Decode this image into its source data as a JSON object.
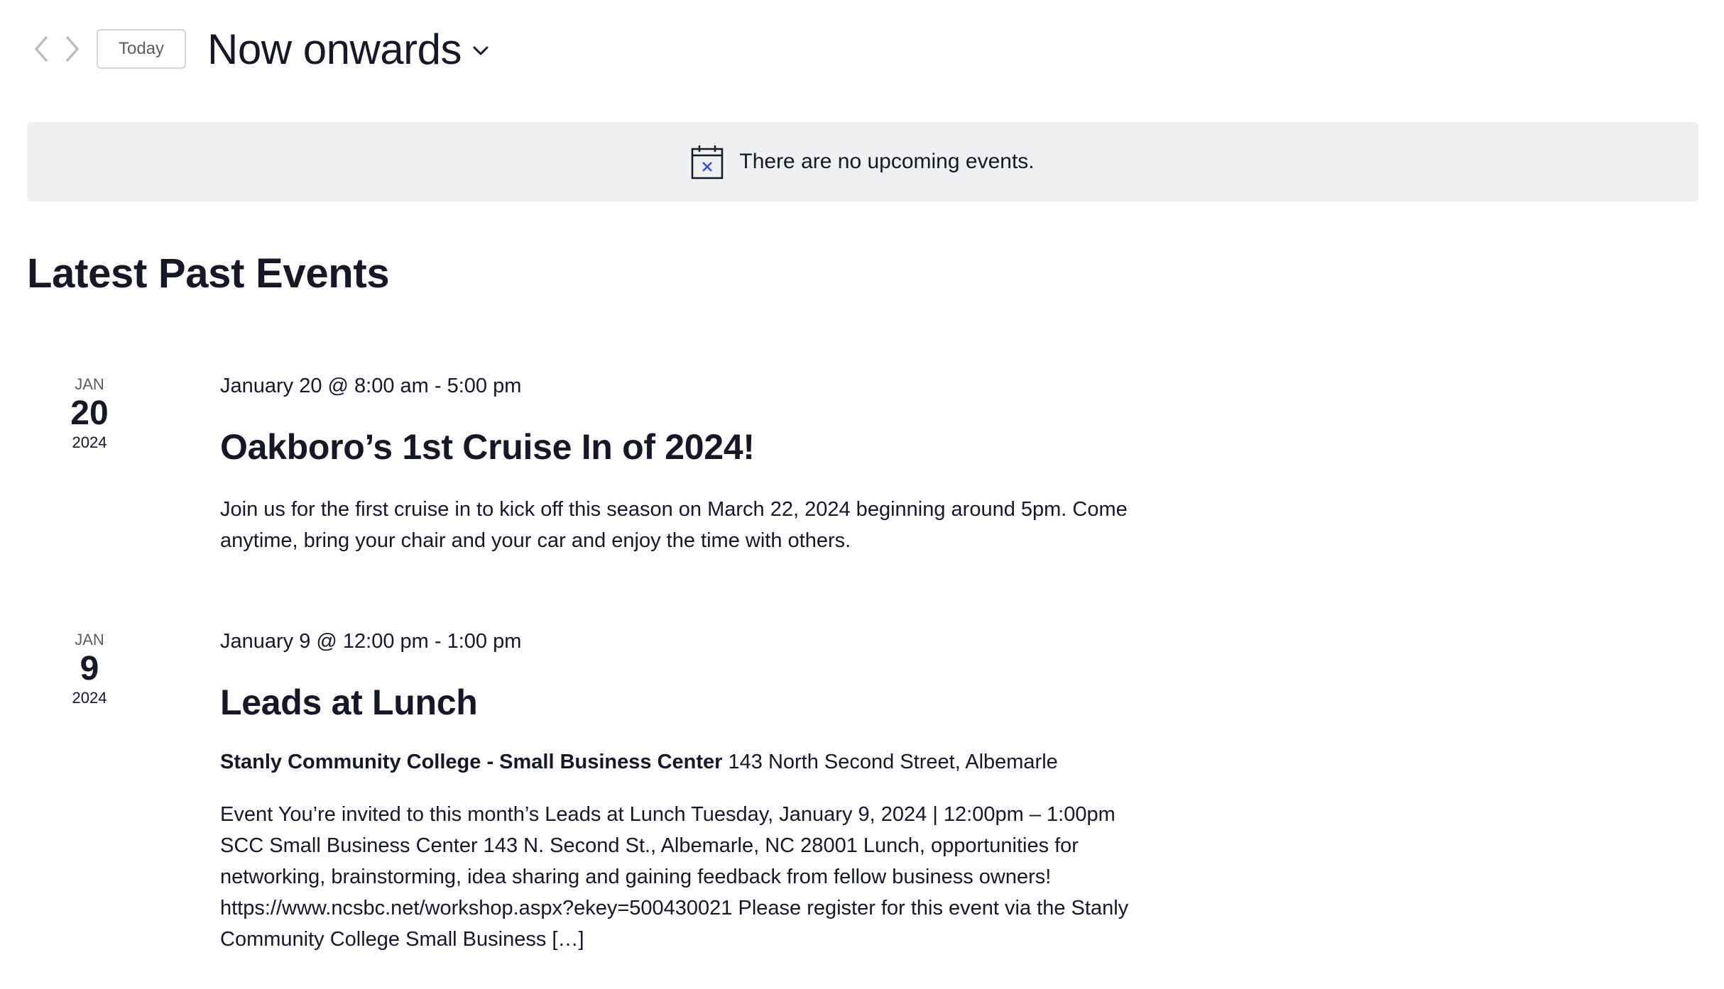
{
  "nav": {
    "prev_icon": "chevron-left-icon",
    "next_icon": "chevron-right-icon",
    "today_label": "Today",
    "range_label": "Now onwards",
    "range_icon": "chevron-down-icon"
  },
  "notice": {
    "icon": "calendar-x-icon",
    "text": "There are no upcoming events."
  },
  "section_title": "Latest Past Events",
  "events": [
    {
      "month": "Jan",
      "day": "20",
      "year": "2024",
      "datetime": "January 20 @ 8:00 am - 5:00 pm",
      "title": "Oakboro’s 1st Cruise In of 2024!",
      "venue_name": "",
      "venue_address": "",
      "description": "Join us for the first cruise in to kick off this season on March 22, 2024 beginning around 5pm.  Come anytime, bring your chair and your car and enjoy the time with others."
    },
    {
      "month": "Jan",
      "day": "9",
      "year": "2024",
      "datetime": "January 9 @ 12:00 pm - 1:00 pm",
      "title": "Leads at Lunch",
      "venue_name": "Stanly Community College - Small Business Center",
      "venue_address": "143 North Second Street, Albemarle",
      "description": "Event You’re invited to this month’s Leads at Lunch Tuesday, January 9, 2024 | 12:00pm – 1:00pm SCC Small Business Center 143 N. Second St., Albemarle, NC 28001 Lunch, opportunities for networking, brainstorming, idea sharing and gaining feedback from fellow business owners! https://www.ncsbc.net/workshop.aspx?ekey=500430021 Please register for this event via the Stanly Community College Small Business […]"
    }
  ],
  "colors": {
    "text": "#141827",
    "muted": "#5d5d5d",
    "notice_bg": "#eef0f1",
    "icon_accent": "#334aff",
    "border": "#d5d5d5"
  }
}
